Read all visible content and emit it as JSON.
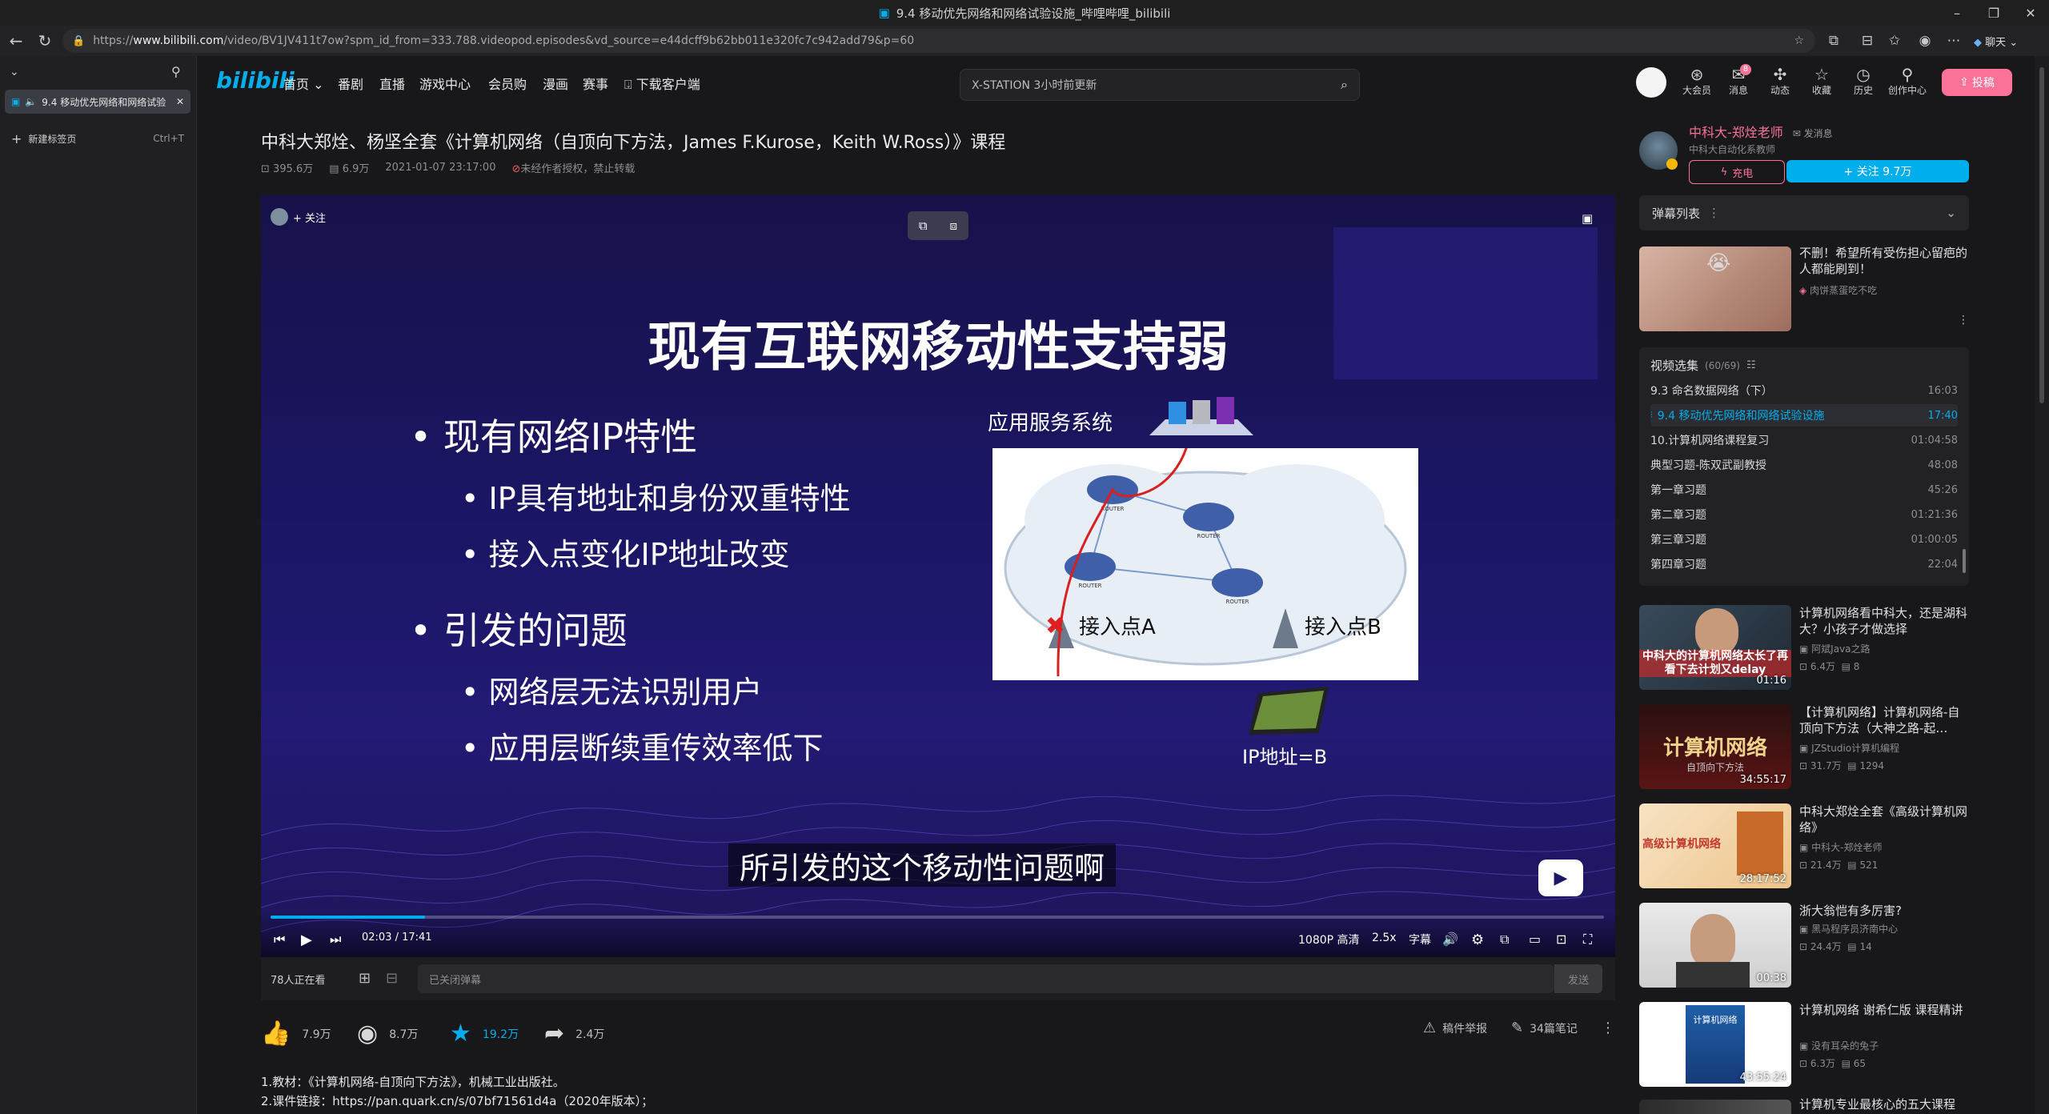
{
  "window": {
    "title": "9.4 移动优先网络和网络试验设施_哔哩哔哩_bilibili"
  },
  "browser": {
    "url_prefix": "https://",
    "url_host": "www.bilibili.com",
    "url_path": "/video/BV1JV411t7ow?spm_id_from=333.788.videopod.episodes&vd_source=e44dcff9b62bb011e320fc7c942add79&p=60",
    "chat_label": "聊天",
    "tab_title": "9.4 移动优先网络和网络试验",
    "new_tab_label": "新建标签页",
    "new_tab_shortcut": "Ctrl+T"
  },
  "header": {
    "logo": "bilibili",
    "nav": [
      "首页",
      "番剧",
      "直播",
      "游戏中心",
      "会员购",
      "漫画",
      "赛事"
    ],
    "download": "下载客户端",
    "search_placeholder": "X-STATION 3小时前更新",
    "icons": [
      {
        "label": "大会员",
        "icon": "vip-icon"
      },
      {
        "label": "消息",
        "icon": "message-icon",
        "badge": "8"
      },
      {
        "label": "动态",
        "icon": "dynamic-icon"
      },
      {
        "label": "收藏",
        "icon": "favorite-icon"
      },
      {
        "label": "历史",
        "icon": "history-icon"
      },
      {
        "label": "创作中心",
        "icon": "creator-icon"
      }
    ],
    "upload": "投稿"
  },
  "video": {
    "title": "中科大郑烇、杨坚全套《计算机网络（自顶向下方法，James F.Kurose，Keith W.Ross）》课程",
    "views": "395.6万",
    "danmaku": "6.9万",
    "date": "2021-01-07 23:17:00",
    "rights": "未经作者授权，禁止转载"
  },
  "player": {
    "follow_label": "+ 关注",
    "slide": {
      "title": "现有互联网移动性支持弱",
      "b1": "现有网络IP特性",
      "b1a": "IP具有地址和身份双重特性",
      "b1b": "接入点变化IP地址改变",
      "b2": "引发的问题",
      "b2a": "网络层无法识别用户",
      "b2b": "应用层断续重传效率低下",
      "app_system": "应用服务系统",
      "ap_a": "接入点A",
      "ap_b": "接入点B",
      "ip_label": "IP地址=B",
      "router_label": "ROUTER"
    },
    "subtitle": "所引发的这个移动性问题啊",
    "time": "02:03 / 17:41",
    "progress": 0.116,
    "quality": "1080P 高清",
    "speed": "2.5x",
    "caption": "字幕"
  },
  "danmaku_bar": {
    "watching": "78人正在看",
    "placeholder": "已关闭弹幕",
    "send": "发送"
  },
  "actions": {
    "like": "7.9万",
    "coin": "8.7万",
    "favorite": "19.2万",
    "share": "2.4万",
    "report": "稿件举报",
    "notes": "34篇笔记"
  },
  "description": {
    "line1": "1.教材：《计算机网络-自顶向下方法》，机械工业出版社。",
    "line2": "2.课件链接：https://pan.quark.cn/s/07bf71561d4a（2020年版本）；"
  },
  "uploader": {
    "name": "中科大-郑烇老师",
    "message": "发消息",
    "desc": "中科大自动化系教师",
    "charge": "充电",
    "follow": "+ 关注 9.7万"
  },
  "dm_list": {
    "label": "弹幕列表"
  },
  "ad": {
    "title": "不删！希望所有受伤担心留疤的人都能刷到！",
    "source": "肉饼蒸蛋吃不吃"
  },
  "playlist": {
    "title": "视频选集",
    "count": "(60/69)",
    "items": [
      {
        "title": "9.3 命名数据网络（下）",
        "duration": "16:03"
      },
      {
        "title": "9.4 移动优先网络和网络试验设施",
        "duration": "17:40",
        "active": true
      },
      {
        "title": "10.计算机网络课程复习",
        "duration": "01:04:58"
      },
      {
        "title": "典型习题-陈双武副教授",
        "duration": "48:08"
      },
      {
        "title": "第一章习题",
        "duration": "45:26"
      },
      {
        "title": "第二章习题",
        "duration": "01:21:36"
      },
      {
        "title": "第三章习题",
        "duration": "01:00:05"
      },
      {
        "title": "第四章习题",
        "duration": "22:04"
      }
    ]
  },
  "recommendations": [
    {
      "title": "计算机网络看中科大，还是湖科大？小孩子才做选择",
      "up": "阿斌Java之路",
      "views": "6.4万",
      "dm": "8",
      "duration": "01:16",
      "thumb_text": "中科大的计算机网络太长了再看下去计划又delay"
    },
    {
      "title": "【计算机网络】计算机网络-自顶向下方法（大神之路-起…",
      "up": "JZStudio计算机编程",
      "views": "31.7万",
      "dm": "1294",
      "duration": "34:55:17",
      "thumb_text": "计算机网络",
      "thumb_sub": "自顶向下方法"
    },
    {
      "title": "中科大郑烇全套《高级计算机网络》",
      "up": "中科大-郑烇老师",
      "views": "21.4万",
      "dm": "521",
      "duration": "28:17:52",
      "thumb_text": "高级计算机网络"
    },
    {
      "title": "浙大翁恺有多厉害?",
      "up": "黑马程序员济南中心",
      "views": "24.4万",
      "dm": "14",
      "duration": "00:38"
    },
    {
      "title": "计算机网络 谢希仁版 课程精讲",
      "up": "没有耳朵的兔子",
      "views": "6.3万",
      "dm": "65",
      "duration": "43:55:24",
      "thumb_text": "计算机网络"
    },
    {
      "title": "计算机专业最核心的五大课程"
    }
  ]
}
